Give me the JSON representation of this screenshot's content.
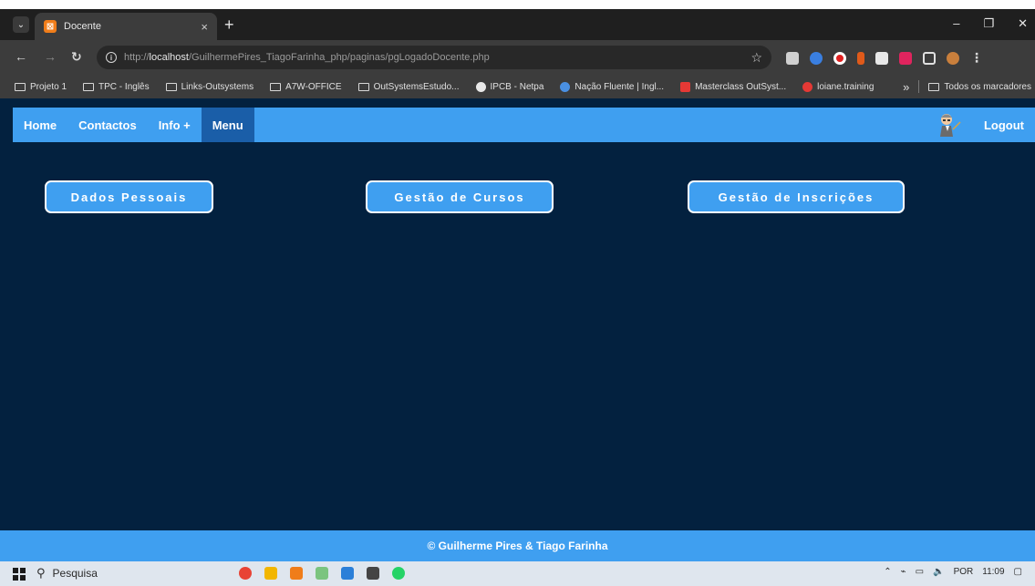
{
  "browser": {
    "tab_title": "Docente",
    "tab_close": "×",
    "new_tab": "+",
    "url_prefix": "http://",
    "url_host": "localhost",
    "url_path": "/GuilhermePires_TiagoFarinha_php/paginas/pgLogadoDocente.php",
    "window_min": "–",
    "window_restore": "❐",
    "window_close": "✕"
  },
  "bookmarks": {
    "items": [
      {
        "label": "Projeto 1",
        "icon": "folder-icon"
      },
      {
        "label": "TPC - Inglês",
        "icon": "folder-icon"
      },
      {
        "label": "Links-Outsystems",
        "icon": "folder-icon"
      },
      {
        "label": "A7W-OFFICE",
        "icon": "folder-icon"
      },
      {
        "label": "OutSystemsEstudo...",
        "icon": "folder-icon"
      },
      {
        "label": "IPCB - Netpa",
        "icon": "globe-icon",
        "color": "#e8e8e8"
      },
      {
        "label": "Nação Fluente | Ingl...",
        "icon": "site-icon",
        "color": "#4a90e2"
      },
      {
        "label": "Masterclass OutSyst...",
        "icon": "site-icon",
        "color": "#e53935"
      },
      {
        "label": "loiane.training",
        "icon": "site-icon",
        "color": "#e53935"
      }
    ],
    "overflow": "»",
    "all_bookmarks": "Todos os marcadores"
  },
  "navbar": {
    "items": [
      {
        "label": "Home"
      },
      {
        "label": "Contactos"
      },
      {
        "label": "Info +"
      },
      {
        "label": "Menu",
        "active": true
      }
    ],
    "logout": "Logout"
  },
  "main": {
    "buttons": [
      {
        "label": "Dados Pessoais"
      },
      {
        "label": "Gestão de Cursos"
      },
      {
        "label": "Gestão de Inscrições"
      }
    ]
  },
  "footer": {
    "text": "© Guilherme Pires & Tiago Farinha"
  },
  "taskbar": {
    "search_placeholder": "Pesquisa",
    "language": "POR",
    "time": "11:09"
  },
  "colors": {
    "page_bg": "#03213f",
    "accent": "#3f9ff0",
    "active_nav": "#1a5ea8"
  }
}
